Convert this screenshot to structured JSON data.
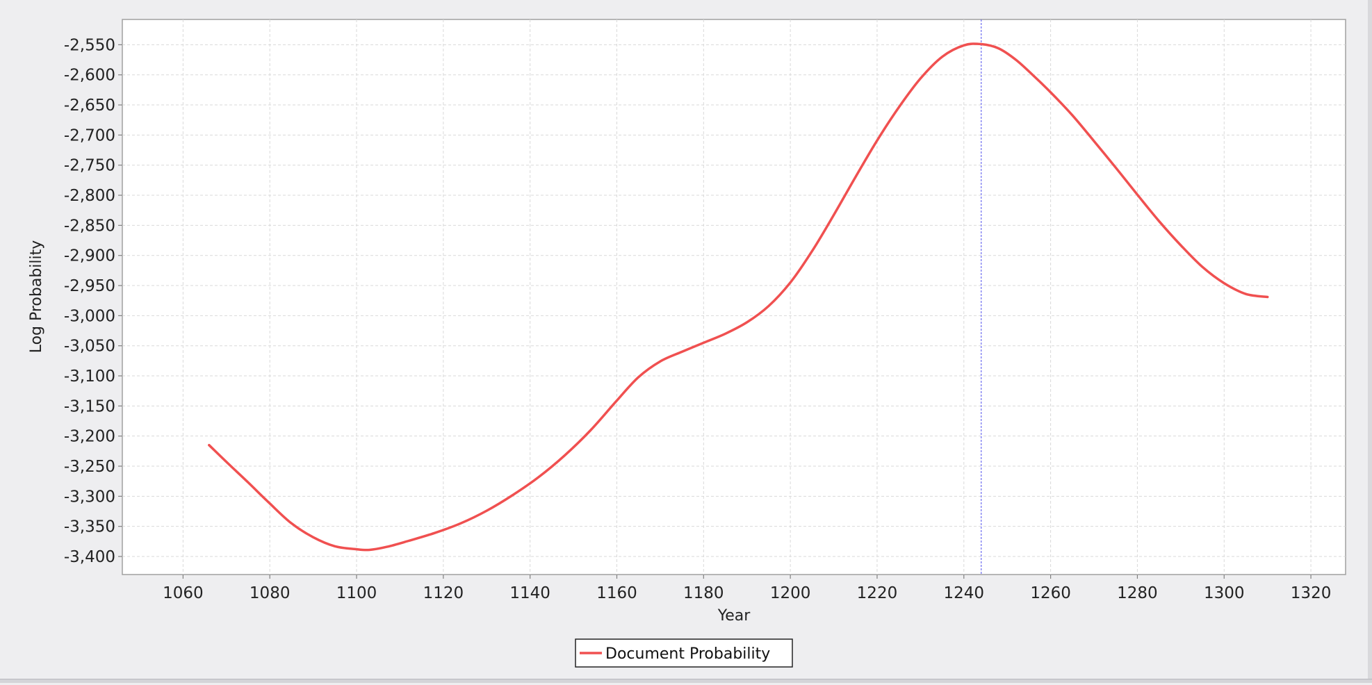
{
  "chart_data": {
    "type": "line",
    "xlabel": "Year",
    "ylabel": "Log Probability",
    "xlim": [
      1046,
      1328
    ],
    "ylim": [
      -3430,
      -2508
    ],
    "x_ticks": [
      1060,
      1080,
      1100,
      1120,
      1140,
      1160,
      1180,
      1200,
      1220,
      1240,
      1260,
      1280,
      1300,
      1320
    ],
    "x_tick_labels": [
      "1060",
      "1080",
      "1100",
      "1120",
      "1140",
      "1160",
      "1180",
      "1200",
      "1220",
      "1240",
      "1260",
      "1280",
      "1300",
      "1320"
    ],
    "y_ticks": [
      -2550,
      -2600,
      -2650,
      -2700,
      -2750,
      -2800,
      -2850,
      -2900,
      -2950,
      -3000,
      -3050,
      -3100,
      -3150,
      -3200,
      -3250,
      -3300,
      -3350,
      -3400
    ],
    "y_tick_labels": [
      "-2,550",
      "-2,600",
      "-2,650",
      "-2,700",
      "-2,750",
      "-2,800",
      "-2,850",
      "-2,900",
      "-2,950",
      "-3,000",
      "-3,050",
      "-3,100",
      "-3,150",
      "-3,200",
      "-3,250",
      "-3,300",
      "-3,350",
      "-3,400"
    ],
    "grid": true,
    "legend_position": "bottom-center",
    "crosshair_x": 1244,
    "series": [
      {
        "name": "Document Probability",
        "color": "#f05050",
        "x": [
          1066,
          1070,
          1075,
          1080,
          1085,
          1090,
          1095,
          1100,
          1103,
          1107,
          1112,
          1118,
          1124,
          1130,
          1136,
          1142,
          1148,
          1154,
          1160,
          1165,
          1170,
          1175,
          1180,
          1185,
          1190,
          1195,
          1200,
          1205,
          1210,
          1215,
          1220,
          1225,
          1230,
          1235,
          1240,
          1244,
          1248,
          1252,
          1256,
          1260,
          1265,
          1270,
          1275,
          1280,
          1285,
          1290,
          1295,
          1300,
          1305,
          1310
        ],
        "y": [
          -3215,
          -3243,
          -3277,
          -3312,
          -3345,
          -3368,
          -3383,
          -3388,
          -3389,
          -3384,
          -3374,
          -3361,
          -3345,
          -3324,
          -3298,
          -3268,
          -3232,
          -3190,
          -3141,
          -3102,
          -3076,
          -3060,
          -3045,
          -3030,
          -3011,
          -2984,
          -2945,
          -2893,
          -2833,
          -2770,
          -2709,
          -2654,
          -2606,
          -2570,
          -2551,
          -2549,
          -2556,
          -2575,
          -2601,
          -2629,
          -2667,
          -2710,
          -2754,
          -2799,
          -2843,
          -2883,
          -2919,
          -2946,
          -2964,
          -2969
        ]
      }
    ]
  },
  "colors": {
    "plot_background": "#ffffff",
    "panel_background": "#eeeef0",
    "gridline": "#d6d6d6",
    "crosshair": "#6a6af0",
    "series": "#f05050"
  }
}
